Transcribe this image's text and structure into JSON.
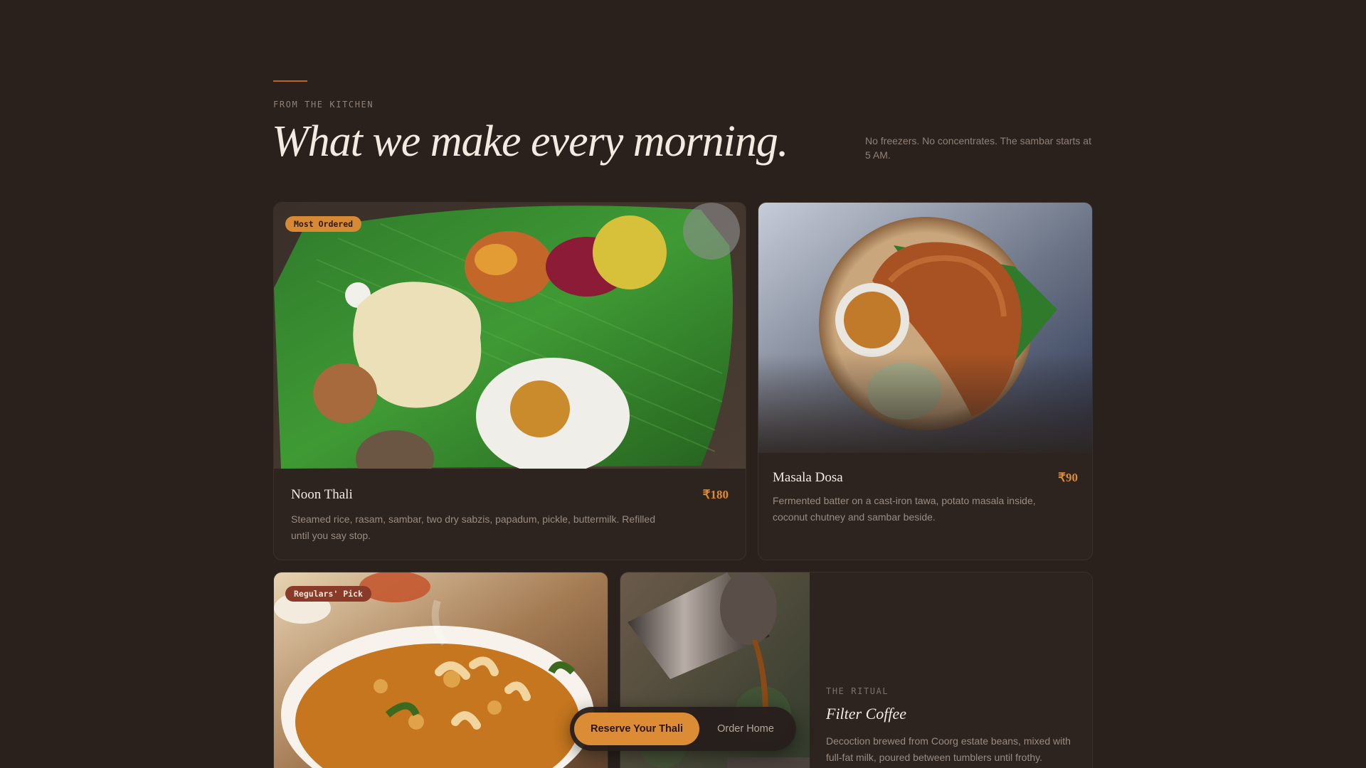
{
  "header": {
    "eyebrow": "FROM THE KITCHEN",
    "headline": "What we make every morning.",
    "note": "No freezers. No concentrates. The sambar starts at 5 AM."
  },
  "menu": {
    "noon_thali": {
      "badge": "Most Ordered",
      "name": "Noon Thali",
      "price": "₹180",
      "description": "Steamed rice, rasam, sambar, two dry sabzis, papadum, pickle, buttermilk. Refilled until you say stop."
    },
    "masala_dosa": {
      "name": "Masala Dosa",
      "price": "₹90",
      "description": "Fermented batter on a cast-iron tawa, potato masala inside, coconut chutney and sambar beside."
    },
    "pongal": {
      "badge": "Regulars' Pick"
    },
    "filter_coffee": {
      "eyebrow": "THE RITUAL",
      "name": "Filter Coffee",
      "description": "Decoction brewed from Coorg estate beans, mixed with full-fat milk, poured between tumblers until frothy."
    }
  },
  "cta": {
    "primary_label": "Reserve Your Thali",
    "secondary_label": "Order Home"
  },
  "colors": {
    "background": "#2a211d",
    "accent": "#db8c35",
    "accent_rule": "#c0612b",
    "price": "#dc8b34"
  }
}
